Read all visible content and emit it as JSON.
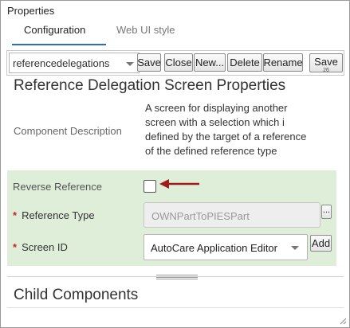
{
  "panel": {
    "title": "Properties"
  },
  "tabs": [
    {
      "label": "Configuration",
      "active": true
    },
    {
      "label": "Web UI style",
      "active": false
    }
  ],
  "toolbar": {
    "selected_item": "referencedelegations",
    "buttons": [
      "Save",
      "Close",
      "New...",
      "Delete",
      "Rename"
    ],
    "save_button": {
      "label": "Save",
      "sub": "26"
    }
  },
  "section": {
    "title": "Reference Delegation Screen Properties",
    "component_description_label": "Component Description",
    "component_description_lines": [
      "A screen for displaying another",
      "screen with a selection which i",
      "defined by the target of a reference",
      "of the defined reference type"
    ]
  },
  "fields": {
    "reverse_reference": {
      "label": "Reverse Reference",
      "checked": false
    },
    "reference_type": {
      "label": "Reference Type",
      "required_marker": "*",
      "placeholder": "OWNPartToPIESPart",
      "browse_label": "..."
    },
    "screen_id": {
      "label": "Screen ID",
      "required_marker": "*",
      "value": "AutoCare Application Editor",
      "add_label": "Add"
    }
  },
  "child_components": {
    "title": "Child Components"
  },
  "colors": {
    "accent": "#2a6ebb",
    "group_bg": "#dfeed9",
    "required": "#cc2222",
    "arrow": "#a01c1c"
  }
}
